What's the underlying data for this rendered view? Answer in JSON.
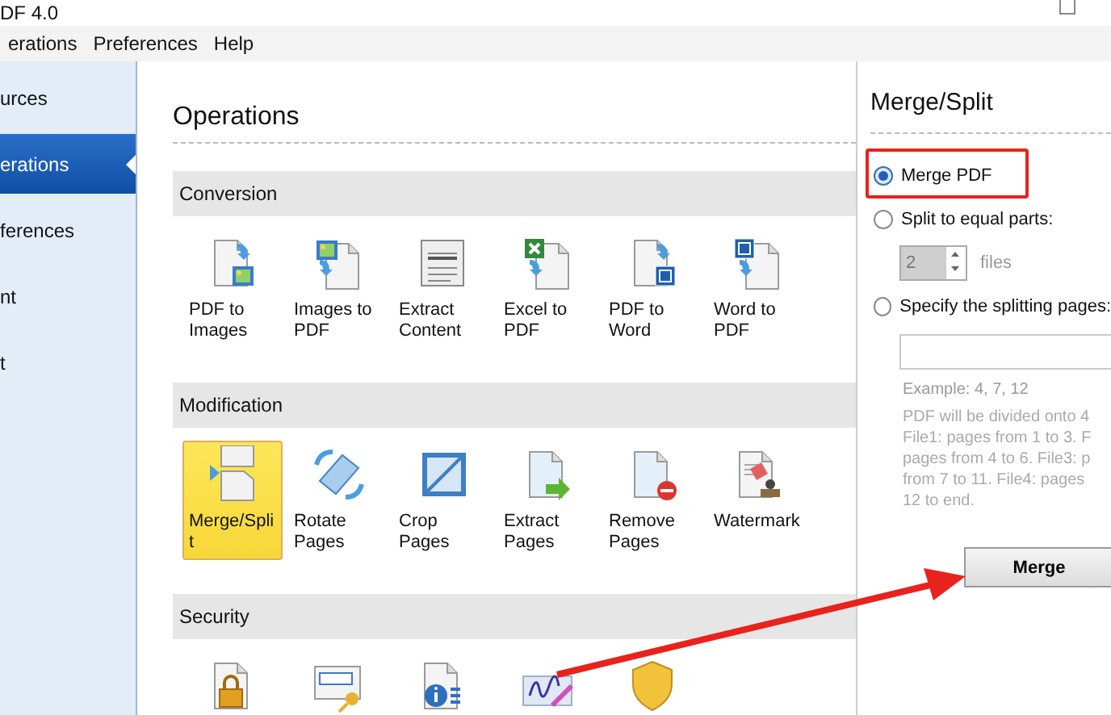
{
  "window": {
    "title": "DF 4.0"
  },
  "menu": [
    {
      "label": "erations"
    },
    {
      "label": "Preferences"
    },
    {
      "label": "Help"
    }
  ],
  "sidebar": {
    "items": [
      {
        "label": "urces",
        "selected": false
      },
      {
        "label": "erations",
        "selected": true
      },
      {
        "label": "ferences",
        "selected": false
      },
      {
        "label": "nt",
        "selected": false
      },
      {
        "label": "t",
        "selected": false
      }
    ]
  },
  "operations": {
    "title": "Operations",
    "sections": [
      {
        "title": "Conversion",
        "items": [
          {
            "kind": "pdf-to-images",
            "label": "PDF to Images",
            "selected": false
          },
          {
            "kind": "images-to-pdf",
            "label": "Images to PDF",
            "selected": false
          },
          {
            "kind": "extract-content",
            "label": "Extract Content",
            "selected": false
          },
          {
            "kind": "excel-to-pdf",
            "label": "Excel to PDF",
            "selected": false
          },
          {
            "kind": "pdf-to-word",
            "label": "PDF to Word",
            "selected": false
          },
          {
            "kind": "word-to-pdf",
            "label": "Word to PDF",
            "selected": false
          }
        ]
      },
      {
        "title": "Modification",
        "items": [
          {
            "kind": "merge-split",
            "label": "Merge/Split",
            "selected": true
          },
          {
            "kind": "rotate",
            "label": "Rotate Pages",
            "selected": false
          },
          {
            "kind": "crop",
            "label": "Crop Pages",
            "selected": false
          },
          {
            "kind": "extract-pages",
            "label": "Extract Pages",
            "selected": false
          },
          {
            "kind": "remove-pages",
            "label": "Remove Pages",
            "selected": false
          },
          {
            "kind": "watermark",
            "label": "Watermark",
            "selected": false
          }
        ]
      },
      {
        "title": "Security",
        "items": [
          {
            "kind": "lock",
            "selected": false
          },
          {
            "kind": "password",
            "selected": false
          },
          {
            "kind": "info",
            "selected": false
          },
          {
            "kind": "signature",
            "selected": false
          },
          {
            "kind": "shield",
            "selected": false
          }
        ]
      }
    ]
  },
  "panel": {
    "title": "Merge/Split",
    "options": [
      {
        "label": "Merge PDF",
        "selected": true
      },
      {
        "label": "Split to equal parts:",
        "selected": false
      },
      {
        "label": "Specify the splitting pages:",
        "selected": false
      }
    ],
    "spinner": {
      "value": "2",
      "unit": "files",
      "disabled": true
    },
    "example": "Example: 4, 7, 12",
    "description": "PDF will be divided onto 4\nFile1: pages from 1 to 3. F\npages from 4 to 6. File3: p\nfrom 7 to 11. File4: pages\n12 to end.",
    "button": "Merge"
  },
  "annotations": {
    "highlight_box": true,
    "arrow": true
  }
}
